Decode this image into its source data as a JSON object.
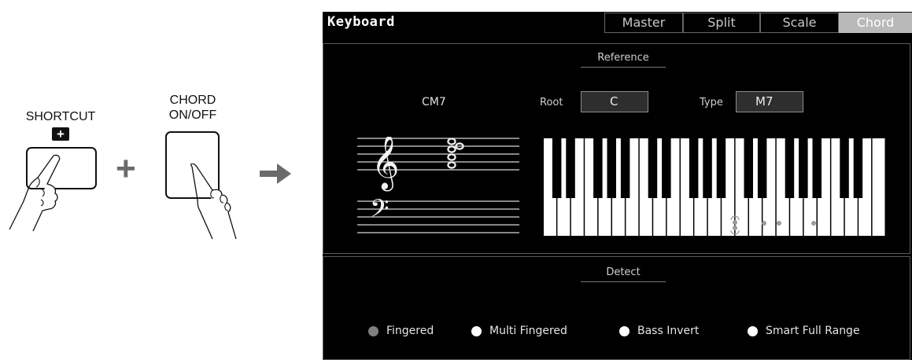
{
  "instruction": {
    "shortcut_label": "SHORTCUT",
    "shortcut_badge": "+",
    "chord_label_line1": "CHORD",
    "chord_label_line2": "ON/OFF",
    "plus_operator": "+"
  },
  "window": {
    "title": "Keyboard",
    "tabs": [
      {
        "label": "Master",
        "active": false
      },
      {
        "label": "Split",
        "active": false
      },
      {
        "label": "Scale",
        "active": false
      },
      {
        "label": "Chord",
        "active": true
      }
    ]
  },
  "reference": {
    "heading": "Reference",
    "chord_name": "CM7",
    "root_label": "Root",
    "root_value": "C",
    "type_label": "Type",
    "type_value": "M7",
    "staff_notes": [
      "C",
      "E",
      "G",
      "B"
    ],
    "highlighted_keys": [
      "C",
      "E",
      "G",
      "B"
    ]
  },
  "detect": {
    "heading": "Detect",
    "options": [
      {
        "label": "Fingered",
        "selected": true
      },
      {
        "label": "Multi Fingered",
        "selected": false
      },
      {
        "label": "Bass Invert",
        "selected": false
      },
      {
        "label": "Smart Full Range",
        "selected": false
      }
    ]
  },
  "colors": {
    "panel_bg": "#000000",
    "active_tab": "#b9b9b9",
    "field_bg": "#2e2e2e",
    "selected_radio": "#808080",
    "operator_gray": "#6b6b6b"
  }
}
